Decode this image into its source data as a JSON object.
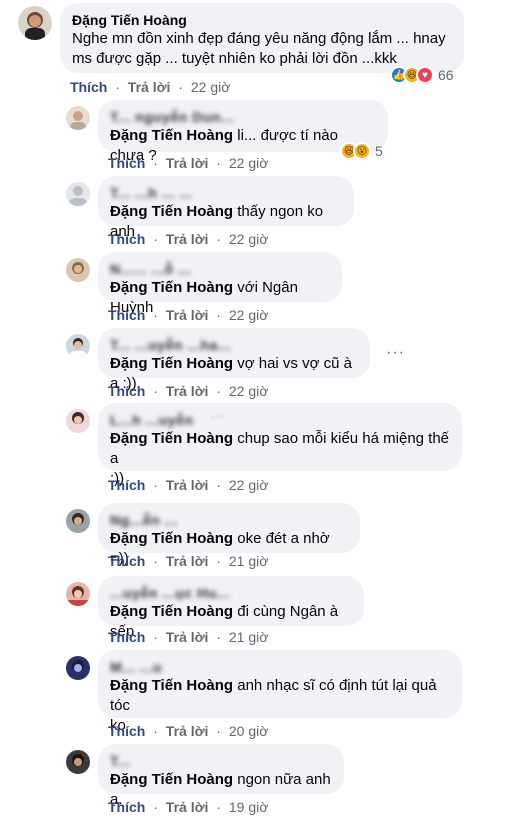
{
  "post_comment": {
    "author": "Đặng Tiến Hoàng",
    "text_line1": "Nghe mn đồn xinh đẹp đáng yêu năng động lắm ... hnay",
    "text_line2": "ms được gặp ... tuyệt nhiên ko phải lời đồn ...kkk",
    "like_label": "Thích",
    "reply_label": "Trả lời",
    "time": "22 giờ",
    "reaction_icons": [
      "like-icon",
      "haha-icon",
      "love-icon"
    ],
    "reaction_count": "66"
  },
  "replies": [
    {
      "author": "T... nguyễn Dun...",
      "mention": "Đặng Tiến Hoàng",
      "text_line1": " li... được tí nào chưa ?",
      "text_line2": "",
      "like_label": "Thích",
      "reply_label": "Trả lời",
      "time": "22 giờ",
      "reaction_icons": [
        "haha-icon",
        "wow-icon"
      ],
      "reaction_count": "5"
    },
    {
      "author": "T... ...h ... ...",
      "mention": "Đặng Tiến Hoàng",
      "text_line1": " thấy ngon ko anh",
      "text_line2": "",
      "like_label": "Thích",
      "reply_label": "Trả lời",
      "time": "22 giờ"
    },
    {
      "author": "N...... ...ỗ ...",
      "mention": "Đặng Tiến Hoàng",
      "text_line1": " với Ngân Huỳnh",
      "text_line2": "",
      "like_label": "Thích",
      "reply_label": "Trả lời",
      "time": "22 giờ"
    },
    {
      "author": "T... ...uyễn ...ha...",
      "mention": "Đặng Tiến Hoàng",
      "text_line1": " vợ hai vs vợ cũ à a :))",
      "text_line2": "",
      "like_label": "Thích",
      "reply_label": "Trả lời",
      "time": "22 giờ"
    },
    {
      "author": "L...h ...uyễn",
      "mention": "Đặng Tiến Hoàng",
      "text_line1": " chup sao mỗi kiểu há miệng thế a",
      "text_line2": ":))",
      "like_label": "Thích",
      "reply_label": "Trả lời",
      "time": "22 giờ"
    },
    {
      "author": "Ng...ễn ...",
      "mention": "Đặng Tiến Hoàng",
      "text_line1": " oke đét a nhờ =))",
      "text_line2": "",
      "like_label": "Thích",
      "reply_label": "Trả lời",
      "time": "21 giờ"
    },
    {
      "author": "...uyễn ...ục Hu...",
      "mention": "Đặng Tiến Hoàng",
      "text_line1": " đi cùng Ngân à sếp",
      "text_line2": "",
      "like_label": "Thích",
      "reply_label": "Trả lời",
      "time": "21 giờ"
    },
    {
      "author": "M... ...u",
      "mention": "Đặng Tiến Hoàng",
      "text_line1": " anh nhạc sĩ có định tút lại quả tóc",
      "text_line2": "ko",
      "like_label": "Thích",
      "reply_label": "Trả lời",
      "time": "20 giờ"
    },
    {
      "author": "T...",
      "mention": "Đặng Tiến Hoàng",
      "text_line1": " ngon nữa anh ạ.",
      "text_line2": "",
      "like_label": "Thích",
      "reply_label": "Trả lời",
      "time": "19 giờ"
    }
  ],
  "watermark": "..."
}
